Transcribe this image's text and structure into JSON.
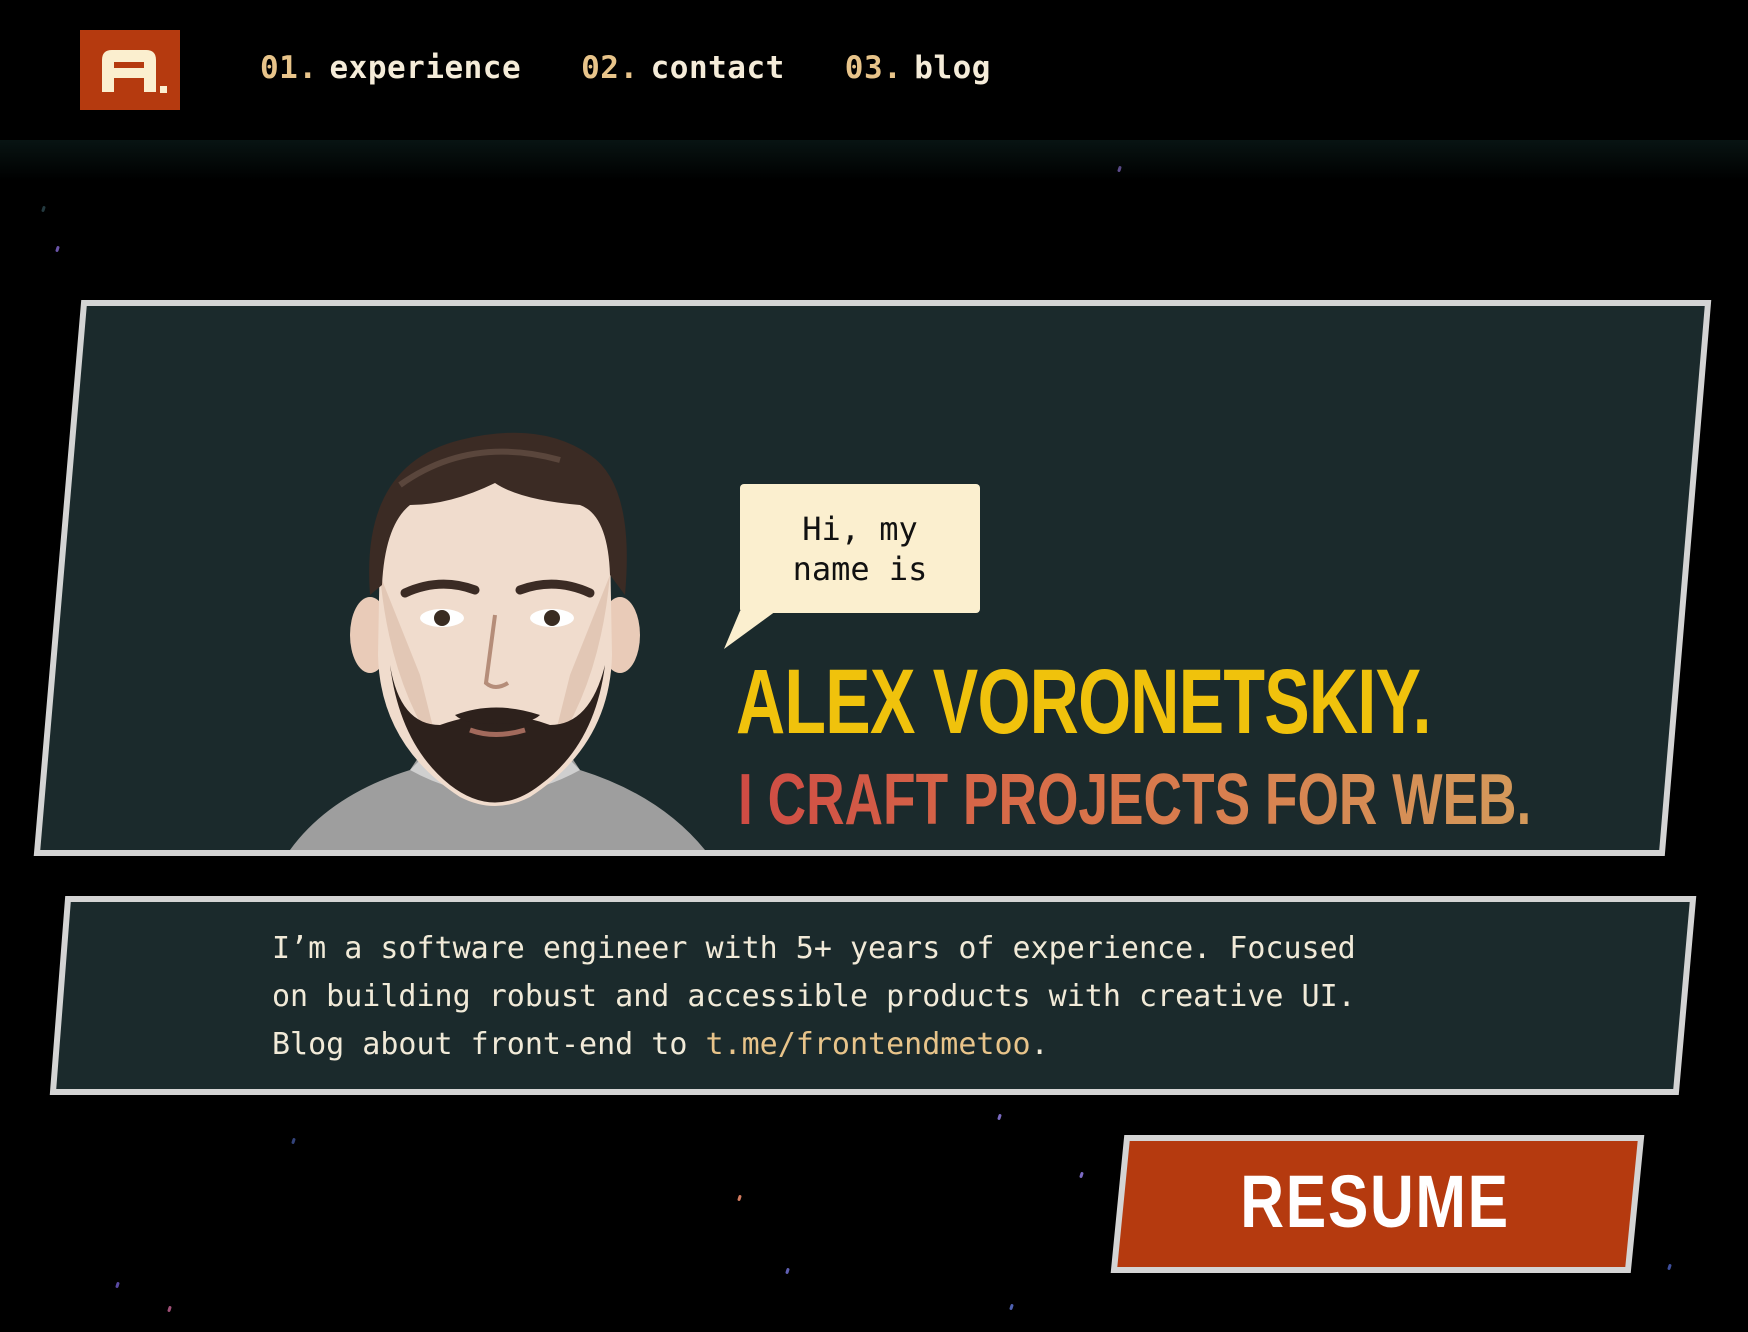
{
  "nav": {
    "logo": "A.",
    "items": [
      {
        "num": "01.",
        "label": "experience"
      },
      {
        "num": "02.",
        "label": "contact"
      },
      {
        "num": "03.",
        "label": "blog"
      }
    ]
  },
  "hero": {
    "greeting": "Hi, my name is",
    "name": "ALEX VORONETSKIY.",
    "tagline": "I CRAFT PROJECTS FOR WEB."
  },
  "about": {
    "line1": "I’m a software engineer with 5+ years of experience. Focused",
    "line2": "on building robust and accessible products with creative UI.",
    "line3_prefix": "Blog about front-end to ",
    "link": "t.me/frontendmetoo",
    "line3_suffix": "."
  },
  "cta": {
    "resume_label": "RESUME"
  },
  "colors": {
    "background": "#000000",
    "panel": "#1b2a2c",
    "panel_border": "#d4d4d4",
    "accent_orange": "#b53a0f",
    "name_yellow": "#f0c20c",
    "nav_number": "#e8c48a",
    "text_light": "#f1ead8"
  }
}
